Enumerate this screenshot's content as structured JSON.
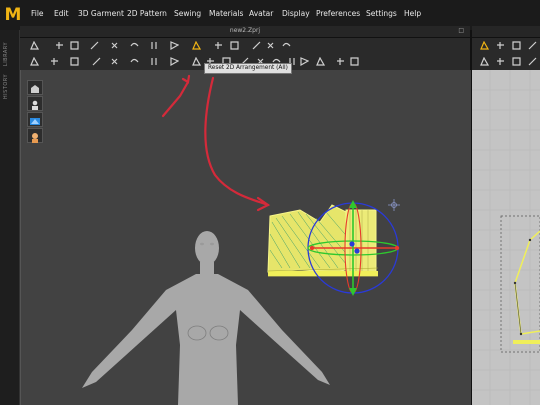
{
  "app": {
    "logo": "M",
    "brand_color": "#f0b414"
  },
  "menu": [
    "File",
    "Edit",
    "3D Garment",
    "2D Pattern",
    "Sewing",
    "Materials",
    "Avatar",
    "Display",
    "Preferences",
    "Settings",
    "Help"
  ],
  "document": {
    "file_name": "new2.Zprj"
  },
  "side_tabs": [
    "LIBRARY",
    "HISTORY"
  ],
  "toolbar": {
    "tooltip": "Reset 2D Arrangement (All)"
  },
  "viewport_3d": {
    "background": "#424242",
    "avatar_color": "#a8a8a8",
    "garment_color": "#f0ef7a",
    "gizmo": {
      "x_axis_color": "#e83a2a",
      "y_axis_color": "#2ec82e",
      "z_axis_color": "#2a3ad8"
    }
  },
  "viewport_2d": {
    "background": "#c4c4c4",
    "pattern_color": "#f0ef5a"
  },
  "annotation": {
    "arrow_color": "#d42a3a"
  },
  "icons": {
    "left_tools": [
      "avatar-display-icon",
      "avatar-select-icon",
      "avatar-texture-icon",
      "avatar-skin-icon"
    ]
  }
}
